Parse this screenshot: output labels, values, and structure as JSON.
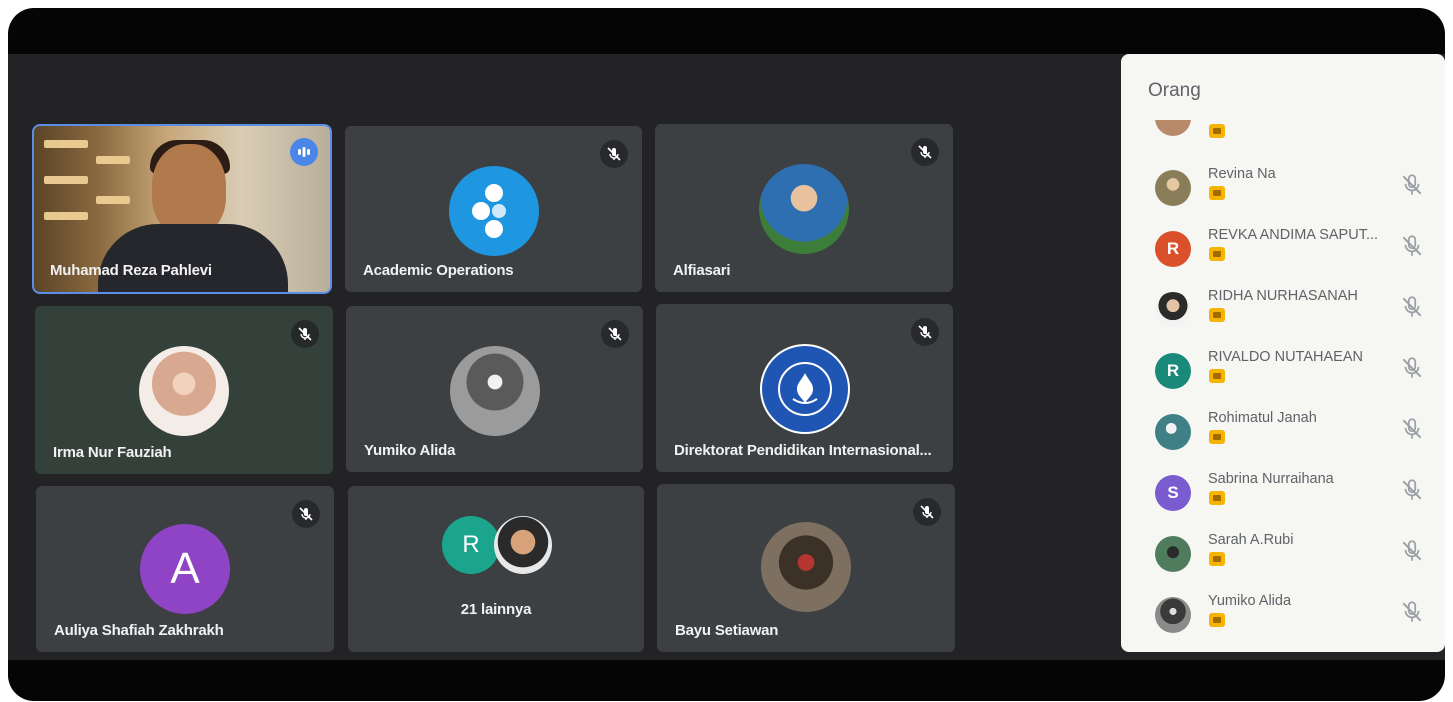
{
  "people_panel": {
    "title": "Orang",
    "participants": [
      {
        "name": "Revina Na",
        "avatar": "photo",
        "color": "#8a7d5a"
      },
      {
        "name": "REVKA ANDIMA SAPUT...",
        "avatar": "letter",
        "initial": "R",
        "color": "#d9502b"
      },
      {
        "name": "RIDHA NURHASANAH",
        "avatar": "photo",
        "color": "#c9b7a2"
      },
      {
        "name": "RIVALDO NUTAHAEAN",
        "avatar": "letter",
        "initial": "R",
        "color": "#198a7a"
      },
      {
        "name": "Rohimatul Janah",
        "avatar": "photo",
        "color": "#3f7f86"
      },
      {
        "name": "Sabrina Nurraihana",
        "avatar": "letter",
        "initial": "S",
        "color": "#7a5bd0"
      },
      {
        "name": "Sarah A.Rubi",
        "avatar": "photo",
        "color": "#4f7c5c"
      },
      {
        "name": "Yumiko Alida",
        "avatar": "photo",
        "color": "#6e6e6e"
      }
    ]
  },
  "tiles": [
    {
      "name": "Muhamad Reza Pahlevi",
      "type": "video",
      "speaking": true
    },
    {
      "name": "Academic Operations",
      "type": "logo",
      "muted": true,
      "color": "#1e96e0"
    },
    {
      "name": "Alfiasari",
      "type": "photo",
      "muted": true,
      "color": "#2d6fb0"
    },
    {
      "name": "Irma Nur Fauziah",
      "type": "photo",
      "muted": true,
      "color": "#e9c7b2"
    },
    {
      "name": "Yumiko Alida",
      "type": "photo",
      "muted": true,
      "color": "#777777"
    },
    {
      "name": "Direktorat Pendidikan Internasional...",
      "type": "logo",
      "muted": true,
      "color": "#1f56b3"
    },
    {
      "name": "Auliya Shafiah Zakhrakh",
      "type": "letter",
      "initial": "A",
      "muted": true,
      "color": "#8e44c4"
    },
    {
      "name": "21 lainnya",
      "type": "group",
      "initial": "R",
      "color": "#1aa58c"
    },
    {
      "name": "Bayu Setiawan",
      "type": "photo",
      "muted": true,
      "color": "#4b4336"
    }
  ],
  "icons": {
    "mute": "mic-off-icon",
    "speaking": "audio-level-icon"
  }
}
